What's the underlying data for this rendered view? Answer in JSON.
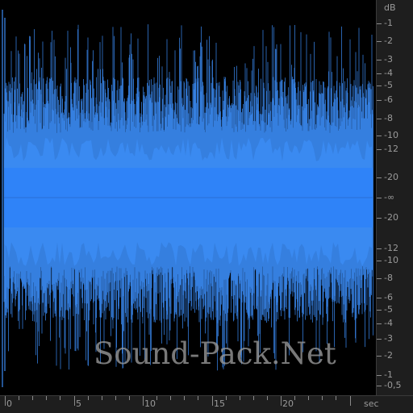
{
  "colors": {
    "background": "#000000",
    "waveform_fill": "#3b8cf5",
    "waveform_core": "#2f83f8",
    "ruler_background": "#1e1e1e",
    "ruler_text": "#9a9a9a"
  },
  "db_ruler": {
    "unit": "dB",
    "labels": [
      "-1",
      "-2",
      "-3",
      "-4",
      "-5",
      "-6",
      "-8",
      "-10",
      "-12",
      "-20",
      "-∞",
      "-20",
      "-12",
      "-10",
      "-8",
      "-6",
      "-5",
      "-4",
      "-3",
      "-2",
      "-1",
      "-0,5"
    ]
  },
  "time_ruler": {
    "unit": "sec",
    "labels": [
      "0",
      "5",
      "10",
      "15",
      "20"
    ],
    "label_values": [
      0,
      5,
      10,
      15,
      20
    ],
    "duration_seconds": 26
  },
  "waveform": {
    "envelope_dbfs": -6,
    "dense_core_dbfs": -20
  },
  "watermark": "Sound-Pack.Net"
}
